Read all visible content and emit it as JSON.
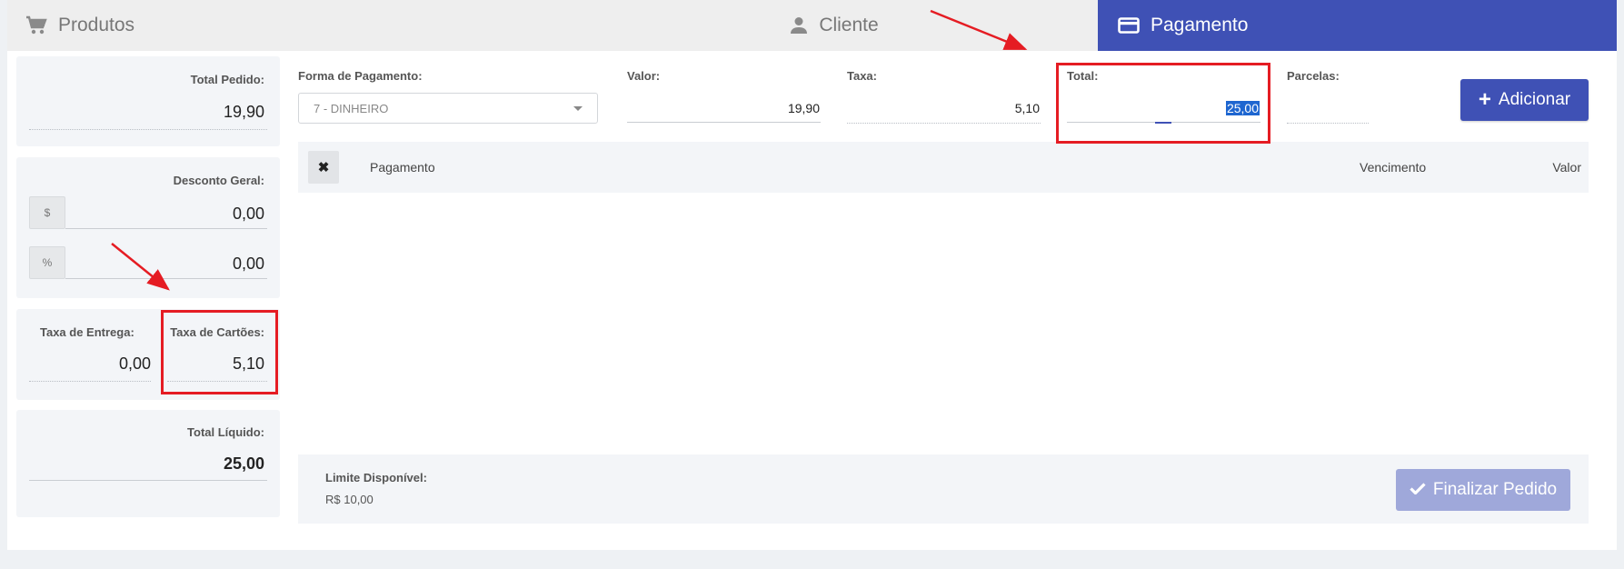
{
  "tabs": [
    {
      "label": "Produtos",
      "icon": "cart-icon",
      "active": false
    },
    {
      "label": "Cliente",
      "icon": "person-icon",
      "active": false
    },
    {
      "label": "Pagamento",
      "icon": "credit-card-icon",
      "active": true
    }
  ],
  "summary": {
    "total_pedido_label": "Total Pedido:",
    "total_pedido_value": "19,90",
    "desconto_label": "Desconto Geral:",
    "desconto_currency_addon": "$",
    "desconto_currency_value": "0,00",
    "desconto_percent_addon": "%",
    "desconto_percent_value": "0,00",
    "taxa_entrega_label": "Taxa de Entrega:",
    "taxa_entrega_value": "0,00",
    "taxa_cartoes_label": "Taxa de Cartões:",
    "taxa_cartoes_value": "5,10",
    "total_liquido_label": "Total Líquido:",
    "total_liquido_value": "25,00"
  },
  "payment_form": {
    "forma_label": "Forma de Pagamento:",
    "forma_value": "7 - DINHEIRO",
    "valor_label": "Valor:",
    "valor_value": "19,90",
    "taxa_label": "Taxa:",
    "taxa_value": "5,10",
    "total_label": "Total:",
    "total_value": "25,00",
    "parcelas_label": "Parcelas:",
    "parcelas_value": "",
    "add_button_label": "Adicionar"
  },
  "table": {
    "remove_icon": "close-icon",
    "columns": [
      "Pagamento",
      "Vencimento",
      "Valor"
    ]
  },
  "footer": {
    "limite_label": "Limite Disponível:",
    "limite_value": "R$ 10,00",
    "finalizar_label": "Finalizar Pedido"
  },
  "colors": {
    "primary": "#3f51b5",
    "primary_disabled": "#9fa8da",
    "annotation_red": "#e51c23"
  }
}
